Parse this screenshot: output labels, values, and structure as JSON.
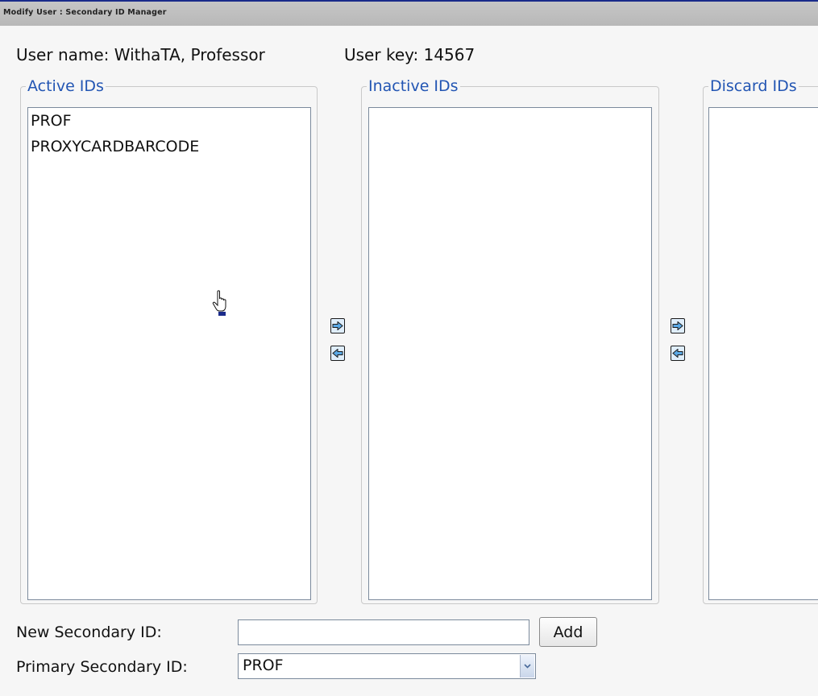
{
  "window": {
    "title": "Modify User : Secondary ID Manager"
  },
  "user": {
    "name_text": "User name: WithaTA, Professor",
    "key_text": "User key: 14567"
  },
  "groups": {
    "active": {
      "legend": "Active IDs",
      "items": [
        "PROF",
        "PROXYCARDBARCODE"
      ]
    },
    "inactive": {
      "legend": "Inactive IDs",
      "items": []
    },
    "discard": {
      "legend": "Discard IDs",
      "items": []
    }
  },
  "new_id": {
    "label": "New Secondary ID:",
    "value": "",
    "add_label": "Add"
  },
  "primary": {
    "label": "Primary Secondary ID:",
    "selected": "PROF"
  },
  "colors": {
    "legend": "#2255b3",
    "titlebar_border": "#1a2b8a",
    "arrow_fill": "#dfeefb"
  }
}
